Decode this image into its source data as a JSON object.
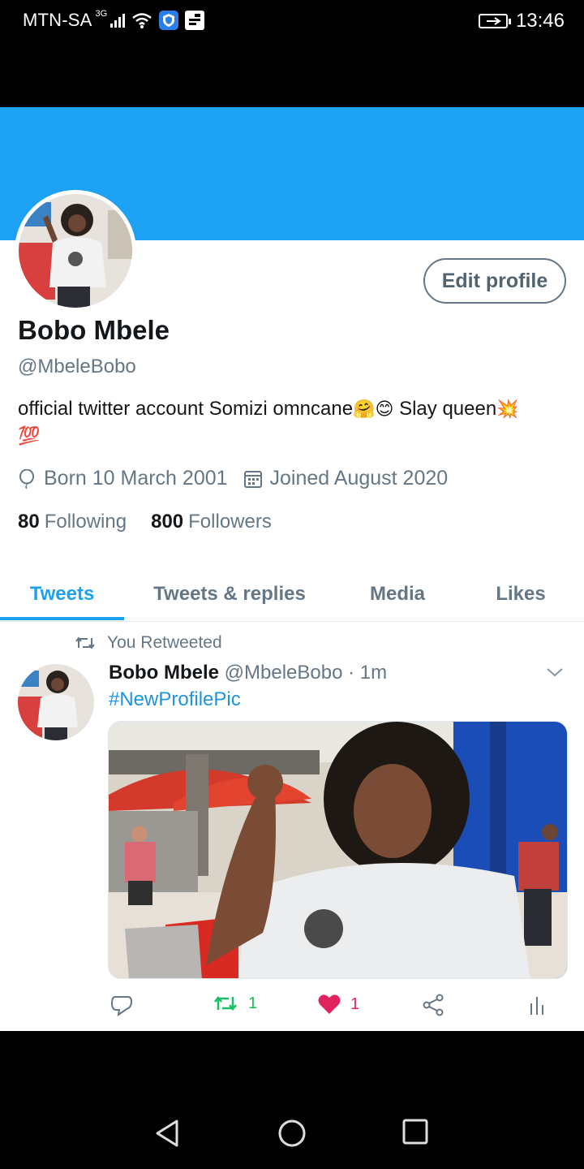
{
  "status_bar": {
    "carrier": "MTN-SA",
    "network": "3G",
    "time": "13:46",
    "icons": [
      "signal-icon",
      "wifi-icon",
      "shield-icon",
      "notification-icon",
      "battery-charging-icon"
    ]
  },
  "profile": {
    "edit_button": "Edit profile",
    "name": "Bobo Mbele",
    "handle": "@MbeleBobo",
    "bio_text": "official twitter account  Somizi omncane",
    "bio_emoji_1": "🤗",
    "bio_emoji_2": "😊",
    "bio_text_2": " Slay queen",
    "bio_emoji_3": "💥",
    "bio_emoji_4": "💯",
    "born": "Born 10 March 2001",
    "joined": "Joined August 2020",
    "following_count": "80",
    "following_label": "Following",
    "followers_count": "800",
    "followers_label": "Followers"
  },
  "tabs": [
    {
      "label": "Tweets",
      "active": true
    },
    {
      "label": "Tweets & replies",
      "active": false
    },
    {
      "label": "Media",
      "active": false
    },
    {
      "label": "Likes",
      "active": false
    }
  ],
  "tweet": {
    "retweet_context": "You Retweeted",
    "author_name": "Bobo Mbele",
    "author_handle": "@MbeleBobo",
    "separator": "·",
    "time": "1m",
    "text": "#NewProfilePic",
    "retweet_count": "1",
    "like_count": "1"
  },
  "colors": {
    "accent": "#1da1f2",
    "retweet_green": "#17bf63",
    "like_red": "#e0245e",
    "text_secondary": "#657786"
  }
}
